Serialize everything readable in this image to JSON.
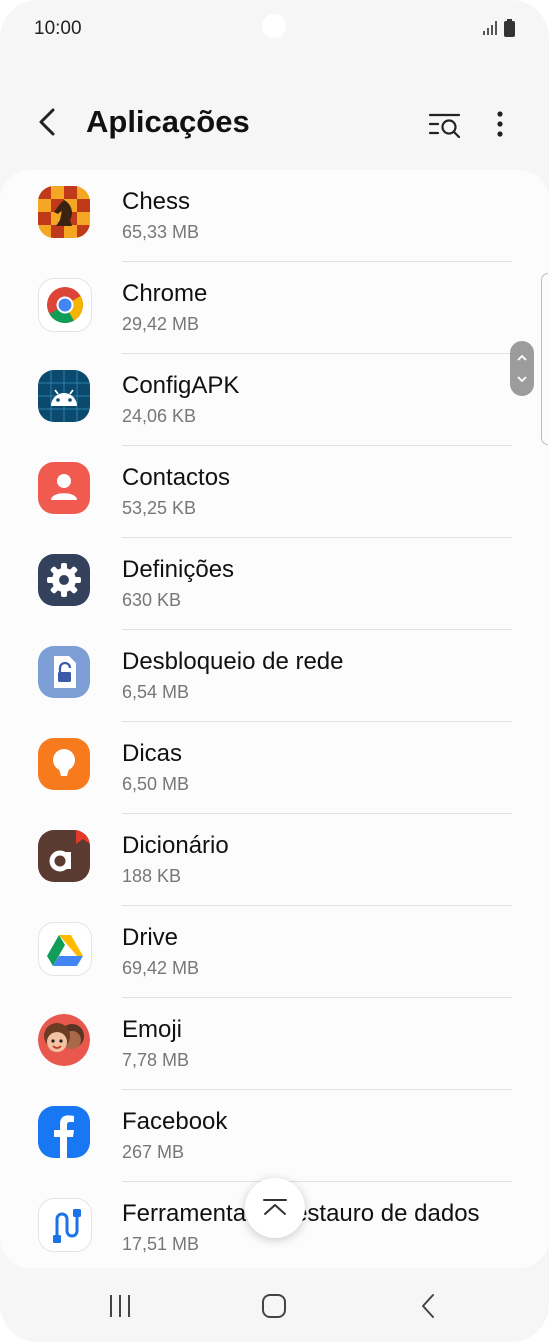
{
  "status": {
    "time": "10:00"
  },
  "header": {
    "title": "Aplicações"
  },
  "apps": [
    {
      "name": "Chess",
      "size": "65,33 MB",
      "icon": "chess-icon"
    },
    {
      "name": "Chrome",
      "size": "29,42 MB",
      "icon": "chrome-icon"
    },
    {
      "name": "ConfigAPK",
      "size": "24,06 KB",
      "icon": "android-icon"
    },
    {
      "name": "Contactos",
      "size": "53,25 KB",
      "icon": "contacts-icon"
    },
    {
      "name": "Definições",
      "size": "630 KB",
      "icon": "settings-gear-icon"
    },
    {
      "name": "Desbloqueio de rede",
      "size": "6,54 MB",
      "icon": "network-unlock-icon"
    },
    {
      "name": "Dicas",
      "size": "6,50 MB",
      "icon": "tips-bulb-icon"
    },
    {
      "name": "Dicionário",
      "size": "188 KB",
      "icon": "dictionary-icon"
    },
    {
      "name": "Drive",
      "size": "69,42 MB",
      "icon": "drive-icon"
    },
    {
      "name": "Emoji",
      "size": "7,78 MB",
      "icon": "emoji-icon"
    },
    {
      "name": "Facebook",
      "size": "267 MB",
      "icon": "facebook-icon"
    },
    {
      "name": "Ferramenta de restauro de dados",
      "size": "17,51 MB",
      "icon": "data-restore-icon"
    }
  ],
  "icons": {
    "back": "back-arrow-icon",
    "search": "search-filter-icon",
    "more": "more-options-icon",
    "scroll_to_top": "scroll-to-top-icon"
  },
  "colors": {
    "accent": "#1a73e8",
    "background": "#f6f6f6"
  }
}
